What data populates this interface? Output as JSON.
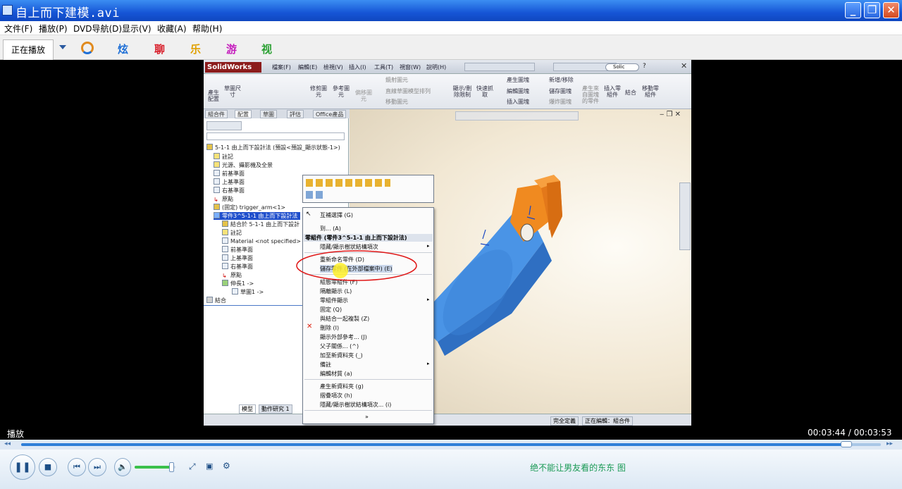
{
  "window": {
    "title": "自上而下建模.avi",
    "controls": [
      "_",
      "❐",
      "✕"
    ]
  },
  "menu": [
    "文件(F)",
    "播放(P)",
    "DVD导航(D)",
    "显示(V)",
    "收藏(A)",
    "帮助(H)"
  ],
  "tabs": {
    "now_playing": "正在播放",
    "categories": [
      "炫",
      "聊",
      "乐",
      "游",
      "视"
    ]
  },
  "solidworks": {
    "logo": "SolidWorks",
    "menu": [
      "檔案(F)",
      "編輯(E)",
      "檢視(V)",
      "插入(I)",
      "工具(T)",
      "視窗(W)",
      "說明(H)"
    ],
    "search": "Solic",
    "ribbon": {
      "left": [
        "產生配置",
        "草圖尺寸"
      ],
      "mid": [
        "修剪圖元",
        "參考圖元",
        "偏移圖元"
      ],
      "mirror": [
        "鏡射圖元",
        "直線草圖模型排列",
        "移動圖元"
      ],
      "right": [
        "顯示/刪除限制",
        "快速抓取"
      ],
      "assembly": [
        "產生圖塊",
        "新增/移除",
        "編輯圖塊",
        "儲存圖塊",
        "插入圖塊",
        "爆炸圖塊"
      ],
      "far": [
        "產生來自圖塊的零件",
        "插入零組件",
        "結合",
        "移動零組件"
      ]
    },
    "panel_tabs": [
      "組合件",
      "配置",
      "草圖",
      "評估",
      "Office產品"
    ],
    "tree": [
      "5-1-1 由上而下設計法 (預設<預設_顯示狀態-1>)",
      "註記",
      "光源、攝影機及全景",
      "前基準面",
      "上基準面",
      "右基準面",
      "原點",
      "(固定) trigger_arm<1>",
      "零件3^5-1-1 由上而下設計法",
      "結合於 5-1-1 由上而下設計",
      "註記",
      "Material <not specified>",
      "前基準面",
      "上基準面",
      "右基準面",
      "原點",
      "伸長1 ->",
      "草圖1 ->",
      "結合"
    ],
    "model_tabs": [
      "模型",
      "動作研究 1"
    ],
    "status": [
      "完全定義",
      "正在編輯：組合件"
    ],
    "context_menu": {
      "items": [
        "互補選擇 (G)",
        "到... (A)",
        "零組件 (零件3^5-1-1 由上而下設計法)",
        "隱藏/顯示樹狀結構項次",
        "重新命名零件 (D)",
        "儲存零件 (在外部檔案中) (E)",
        "組態零組件 (F)",
        "隔離顯示 (L)",
        "零組件顯示",
        "固定 (Q)",
        "與結合一起複製 (Z)",
        "刪除 (I)",
        "顯示外部參考... (J)",
        "父子關係... (^)",
        "加至新資料夾 (_)",
        "備註",
        "編輯材質 (a)",
        "產生新資料夾 (g)",
        "摺疊項次 (h)",
        "隱藏/顯示樹狀結構項次... (i)",
        "»"
      ]
    }
  },
  "player": {
    "status": "播放",
    "time": "00:03:44 / 00:03:53",
    "progress": 0.96,
    "volume": 0.9,
    "info": "绝不能让男友看的东东  图"
  }
}
